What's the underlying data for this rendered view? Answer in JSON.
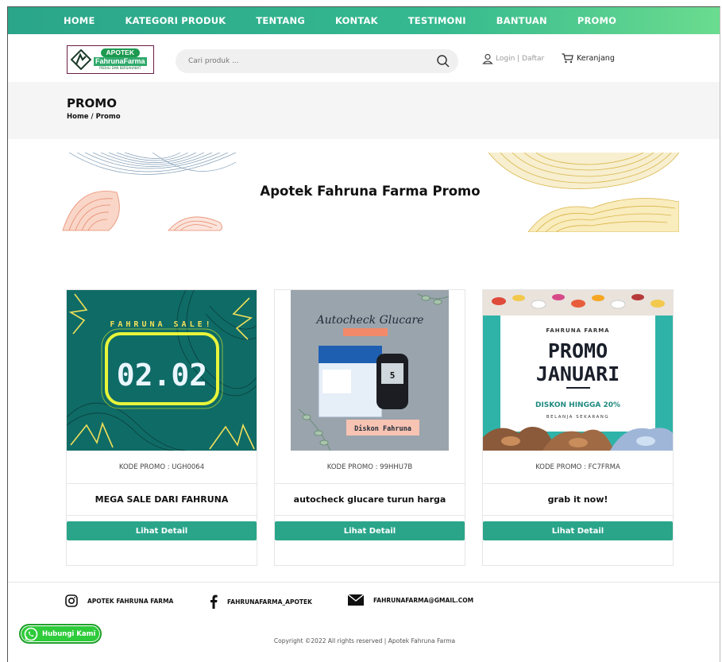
{
  "nav": {
    "items": [
      "HOME",
      "KATEGORI PRODUK",
      "TENTANG",
      "KONTAK",
      "TESTIMONI",
      "BANTUAN",
      "PROMO"
    ]
  },
  "logo": {
    "top": "APOTEK",
    "name": "FahrunaFarma",
    "sub": "PEDULI DAN BERSAHABAT"
  },
  "search": {
    "placeholder": "Cari produk ..."
  },
  "account": {
    "login": "Login | Daftar",
    "cart": "Keranjang"
  },
  "pagehead": {
    "title": "PROMO",
    "breadcrumb": "Home / Promo"
  },
  "banner": {
    "title": "Apotek Fahruna Farma Promo"
  },
  "promos": [
    {
      "code": "KODE PROMO : UGH0064",
      "title": "MEGA SALE DARI FAHRUNA",
      "button": "Lihat Detail",
      "image": {
        "headline": "FAHRUNA SALE!",
        "big": "02.02"
      }
    },
    {
      "code": "KODE PROMO : 99HHU7B",
      "title": "autocheck glucare turun harga",
      "button": "Lihat Detail",
      "image": {
        "headline": "Autocheck Glucare",
        "tag": "Diskon Fahruna"
      }
    },
    {
      "code": "KODE PROMO : FC7FRMA",
      "title": "grab it now!",
      "button": "Lihat Detail",
      "image": {
        "brand": "FAHRUNA FARMA",
        "line1": "PROMO",
        "line2": "JANUARI",
        "discount": "DISKON HINGGA 20%",
        "cta": "BELANJA SEKARANG"
      }
    }
  ],
  "footer": {
    "instagram": "APOTEK FAHRUNA FARMA",
    "facebook": "FAHRUNAFARMA_APOTEK",
    "email": "FAHRUNAFARMA@GMAIL.COM",
    "copyright": "Copyright ©2022 All rights reserved | Apotek Fahruna Farma",
    "whatsapp": "Hubungi Kami"
  }
}
